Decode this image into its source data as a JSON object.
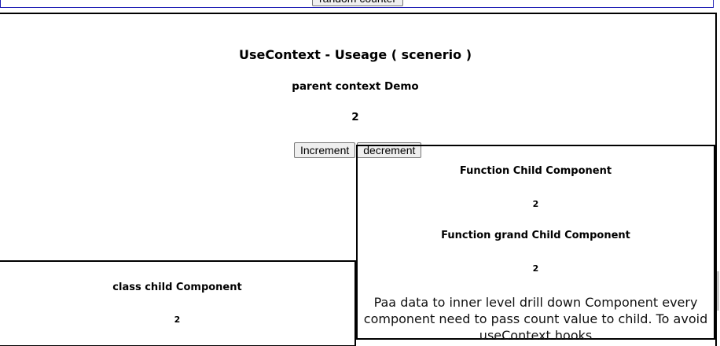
{
  "top": {
    "random_counter_label": "random counter"
  },
  "parent": {
    "title": "UseContext - Useage ( scenerio )",
    "subtitle": "parent context Demo",
    "count": "2",
    "increment_label": "Increment",
    "decrement_label": "decrement"
  },
  "function_child": {
    "heading": "Function Child Component",
    "count": "2",
    "grand_heading": "Function grand Child Component",
    "grand_count": "2",
    "paragraph": "Paa data to inner level drill down Component every component need to pass count value to child. To avoid useContext hooks"
  },
  "class_child": {
    "heading": "class child Component",
    "count": "2"
  }
}
